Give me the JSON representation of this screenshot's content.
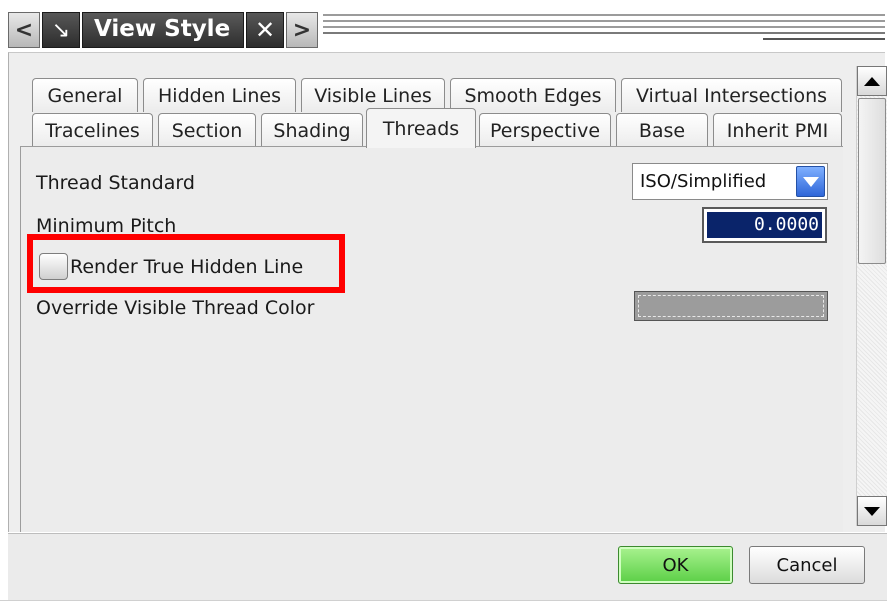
{
  "titlebar": {
    "title": "View Style",
    "back_glyph": "<",
    "forward_glyph": ">",
    "close_glyph": "✕",
    "dock_glyph": "↘"
  },
  "tabs": {
    "row1": [
      "General",
      "Hidden Lines",
      "Visible Lines",
      "Smooth Edges",
      "Virtual Intersections"
    ],
    "row2": [
      "Tracelines",
      "Section",
      "Shading",
      "Threads",
      "Perspective",
      "Base",
      "Inherit PMI"
    ],
    "active": "Threads"
  },
  "fields": {
    "thread_standard_label": "Thread Standard",
    "thread_standard_value": "ISO/Simplified",
    "minimum_pitch_label": "Minimum Pitch",
    "minimum_pitch_value": "0.0000",
    "render_hidden_label": "Render True Hidden Line",
    "render_hidden_checked": false,
    "override_color_label": "Override Visible Thread Color"
  },
  "buttons": {
    "ok": "OK",
    "cancel": "Cancel"
  },
  "colors": {
    "highlight": "#ff0000",
    "ok_button": "#5bcf46",
    "selection_bg": "#0a246a",
    "thread_color_swatch": "#9c9c9c"
  }
}
